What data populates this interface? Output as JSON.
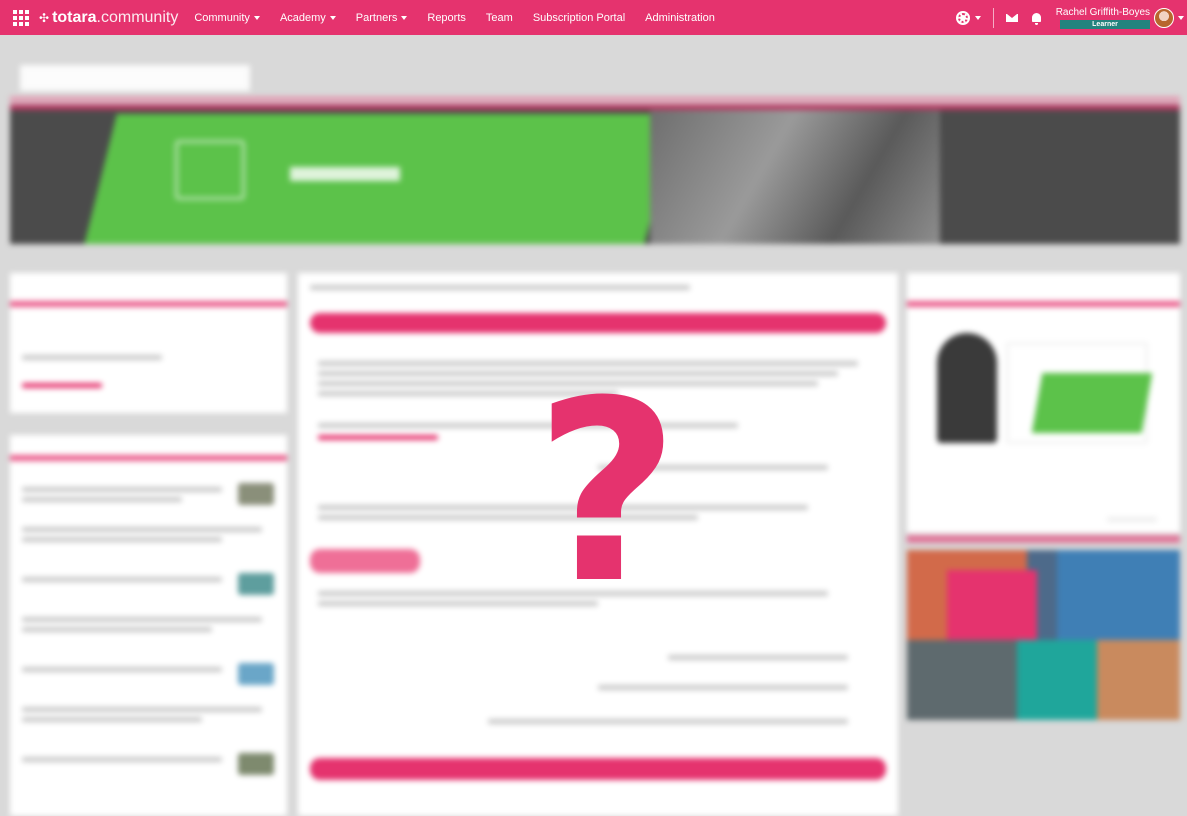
{
  "brand": {
    "logo_bold": "totara",
    "logo_light": ".community",
    "accent_color": "#e5336e",
    "badge_color": "#23837e"
  },
  "nav": {
    "items": [
      {
        "label": "Community",
        "has_menu": true
      },
      {
        "label": "Academy",
        "has_menu": true
      },
      {
        "label": "Partners",
        "has_menu": true
      },
      {
        "label": "Reports",
        "has_menu": false
      },
      {
        "label": "Team",
        "has_menu": false
      },
      {
        "label": "Subscription Portal",
        "has_menu": false
      },
      {
        "label": "Administration",
        "has_menu": false
      }
    ]
  },
  "user": {
    "name": "Rachel Griffith-Boyes",
    "role": "Learner"
  },
  "icons": [
    "app-grid-icon",
    "gear-icon",
    "mail-icon",
    "bell-icon",
    "avatar"
  ],
  "overlay": {
    "symbol": "?"
  }
}
